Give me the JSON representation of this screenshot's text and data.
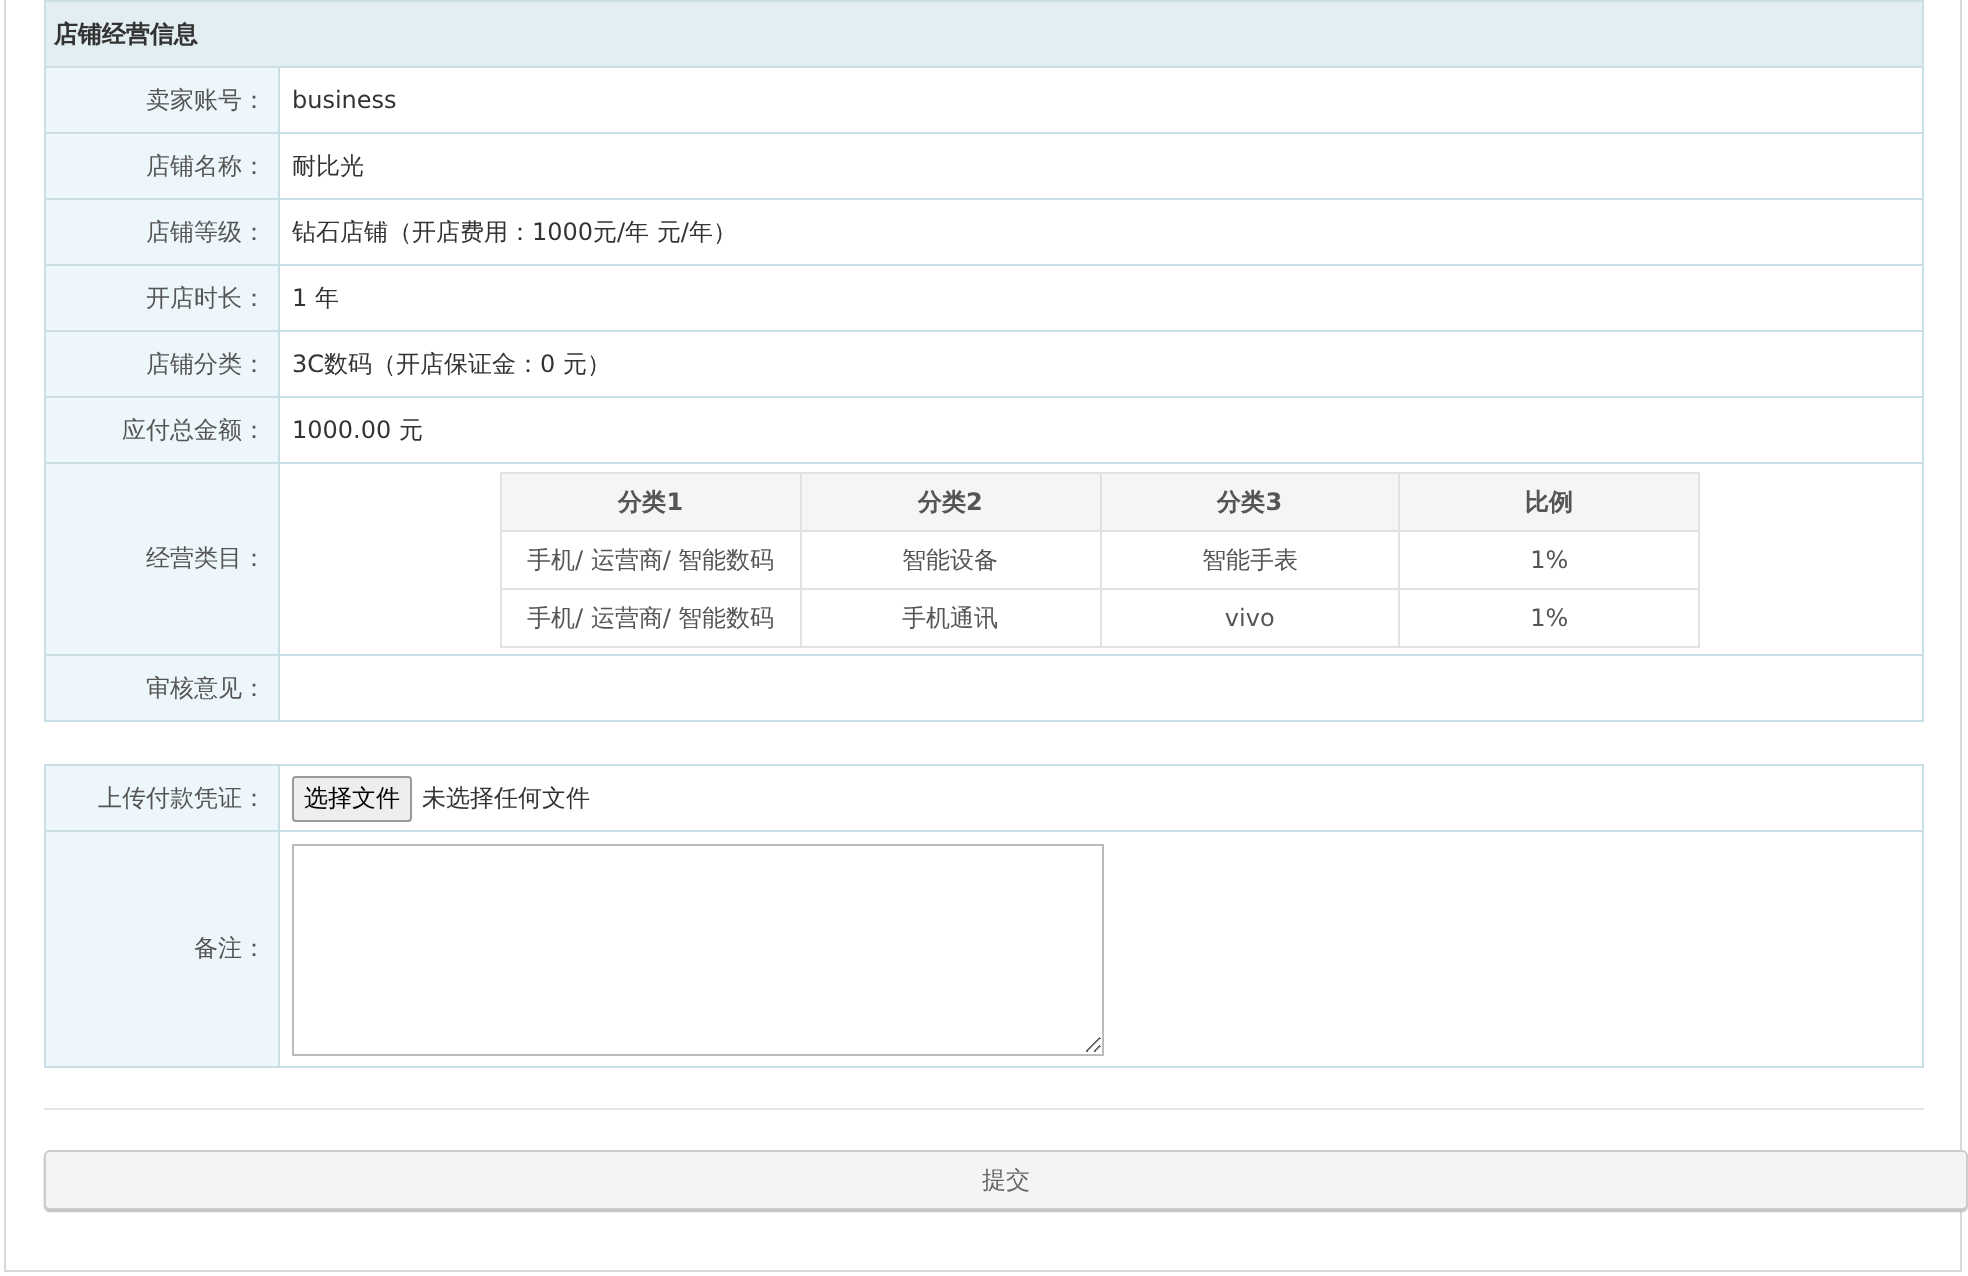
{
  "info_panel": {
    "title": "店铺经营信息",
    "rows": [
      {
        "kind": "text",
        "label": "卖家账号：",
        "value": "business"
      },
      {
        "kind": "text",
        "label": "店铺名称：",
        "value": "耐比光"
      },
      {
        "kind": "text",
        "label": "店铺等级：",
        "value": "钻石店铺（开店费用：1000元/年 元/年）"
      },
      {
        "kind": "text",
        "label": "开店时长：",
        "value": "1 年"
      },
      {
        "kind": "text",
        "label": "店铺分类：",
        "value": "3C数码（开店保证金：0 元）"
      },
      {
        "kind": "text",
        "label": "应付总金额：",
        "value": "1000.00 元"
      },
      {
        "kind": "table",
        "label": "经营类目：",
        "columns": [
          "分类1",
          "分类2",
          "分类3",
          "比例"
        ],
        "rows": [
          [
            "手机/ 运营商/ 智能数码",
            "智能设备",
            "智能手表",
            "1%"
          ],
          [
            "手机/ 运营商/ 智能数码",
            "手机通讯",
            "vivo",
            "1%"
          ]
        ]
      },
      {
        "kind": "empty",
        "label": "审核意见："
      }
    ]
  },
  "upload_panel": {
    "rows": [
      {
        "kind": "file",
        "label": "上传付款凭证：",
        "button": "选择文件",
        "status": "未选择任何文件"
      },
      {
        "kind": "textarea",
        "label": "备注："
      }
    ]
  },
  "submit_button": "提交"
}
